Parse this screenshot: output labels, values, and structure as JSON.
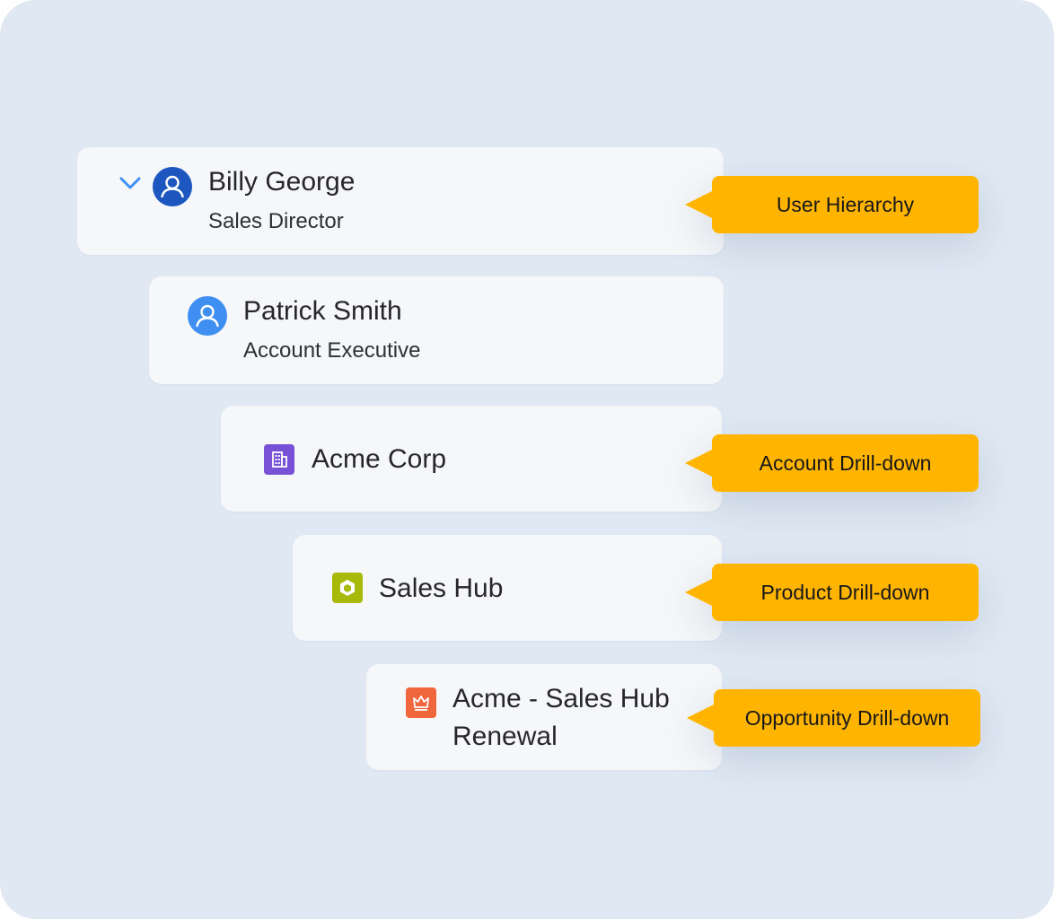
{
  "hierarchy": {
    "user_1": {
      "name": "Billy George",
      "role": "Sales Director",
      "avatar_color": "#1c56be",
      "expanded": true
    },
    "user_2": {
      "name": "Patrick Smith",
      "role": "Account Executive",
      "avatar_color": "#3f8ff2"
    },
    "account": {
      "name": "Acme Corp",
      "icon": "building-icon",
      "icon_color": "#7752d6"
    },
    "product": {
      "name": "Sales Hub",
      "icon": "hexagon-icon",
      "icon_color": "#a9b90a"
    },
    "opportunity": {
      "name_line_1": "Acme - Sales Hub",
      "name_line_2": "Renewal",
      "icon": "crown-icon",
      "icon_color": "#f0663d"
    }
  },
  "callouts": {
    "user_hierarchy": "User Hierarchy",
    "account_drilldown": "Account Drill-down",
    "product_drilldown": "Product Drill-down",
    "opportunity_drilldown": "Opportunity Drill-down"
  },
  "colors": {
    "background": "#dfe8f3",
    "card": "#f5f7f9",
    "callout": "#ffb500",
    "chevron": "#3f8ff2"
  }
}
